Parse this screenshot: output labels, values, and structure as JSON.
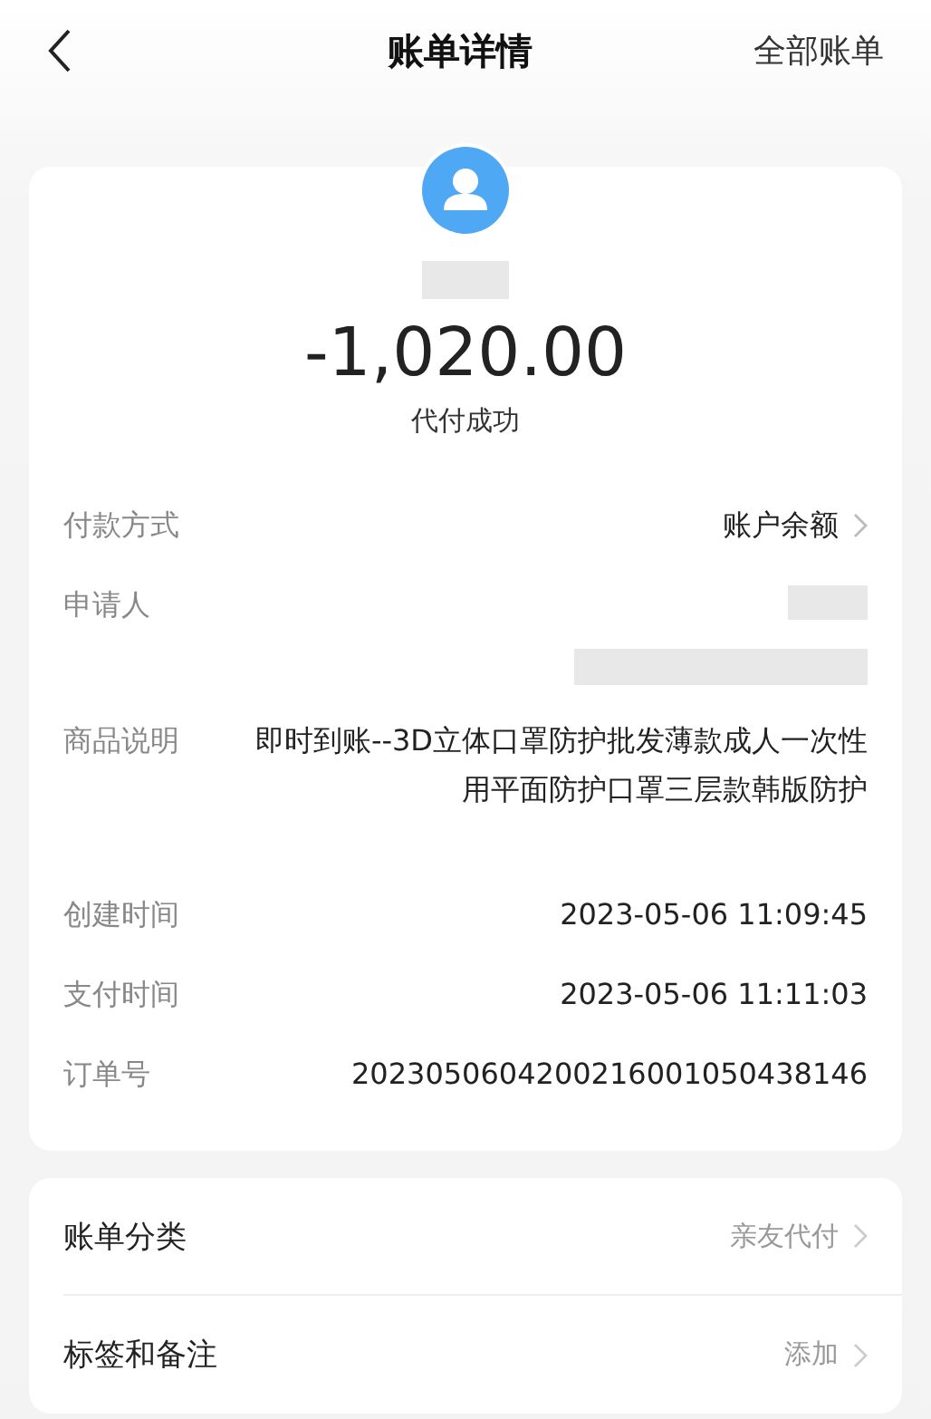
{
  "header": {
    "title": "账单详情",
    "action": "全部账单"
  },
  "summary": {
    "payee_redacted": true,
    "amount": "-1,020.00",
    "status": "代付成功"
  },
  "details": [
    {
      "kind": "link",
      "label": "付款方式",
      "value": "账户余额"
    },
    {
      "kind": "redacted",
      "label": "申请人"
    },
    {
      "kind": "text",
      "label": "商品说明",
      "value": "即时到账--3D立体口罩防护批发薄款成人一次性用平面防护口罩三层款韩版防护"
    },
    {
      "kind": "text",
      "label": "创建时间",
      "value": "2023-05-06 11:09:45"
    },
    {
      "kind": "text",
      "label": "支付时间",
      "value": "2023-05-06 11:11:03"
    },
    {
      "kind": "text",
      "label": "订单号",
      "value": "2023050604200216001050438146"
    }
  ],
  "options": [
    {
      "label": "账单分类",
      "value": "亲友代付"
    },
    {
      "label": "标签和备注",
      "value": "添加"
    }
  ]
}
